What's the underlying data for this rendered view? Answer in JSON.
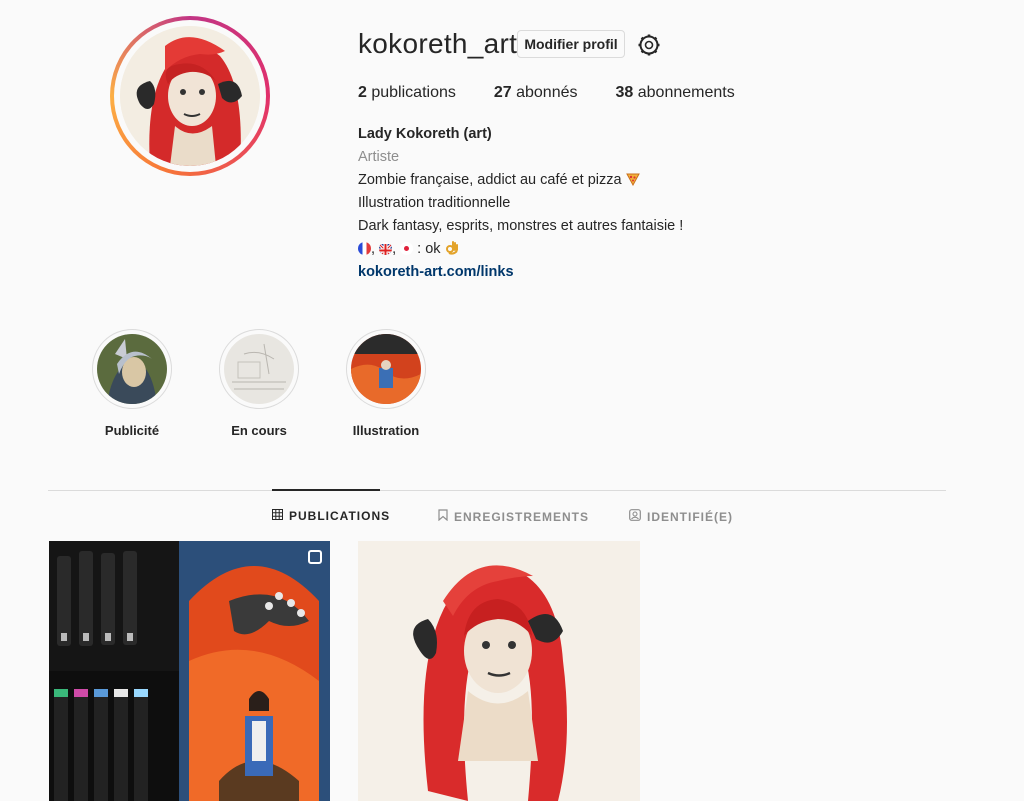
{
  "profile": {
    "username": "kokoreth_art",
    "edit_button": "Modifier profil",
    "settings_icon": "gear-icon"
  },
  "stats": {
    "posts_count": "2",
    "posts_label": "publications",
    "followers_count": "27",
    "followers_label": "abonnés",
    "following_count": "38",
    "following_label": "abonnements"
  },
  "bio": {
    "name": "Lady Kokoreth (art)",
    "category": "Artiste",
    "line1": "Zombie française, addict au café et pizza",
    "line2": "Illustration traditionnelle",
    "line3": "Dark fantasy, esprits, monstres et autres fantaisie !",
    "line4_suffix": ": ok",
    "link": "kokoreth-art.com/links"
  },
  "highlights": [
    {
      "label": "Publicité"
    },
    {
      "label": "En cours"
    },
    {
      "label": "Illustration"
    }
  ],
  "tabs": [
    {
      "label": "PUBLICATIONS",
      "icon": "grid-icon",
      "active": true
    },
    {
      "label": "ENREGISTREMENTS",
      "icon": "bookmark-icon",
      "active": false
    },
    {
      "label": "IDENTIFIÉ(E)",
      "icon": "tagged-icon",
      "active": false
    }
  ],
  "colors": {
    "accent_link": "#00376b",
    "ring_gradient_start": "#c13584",
    "ring_gradient_end": "#fcaf45"
  }
}
